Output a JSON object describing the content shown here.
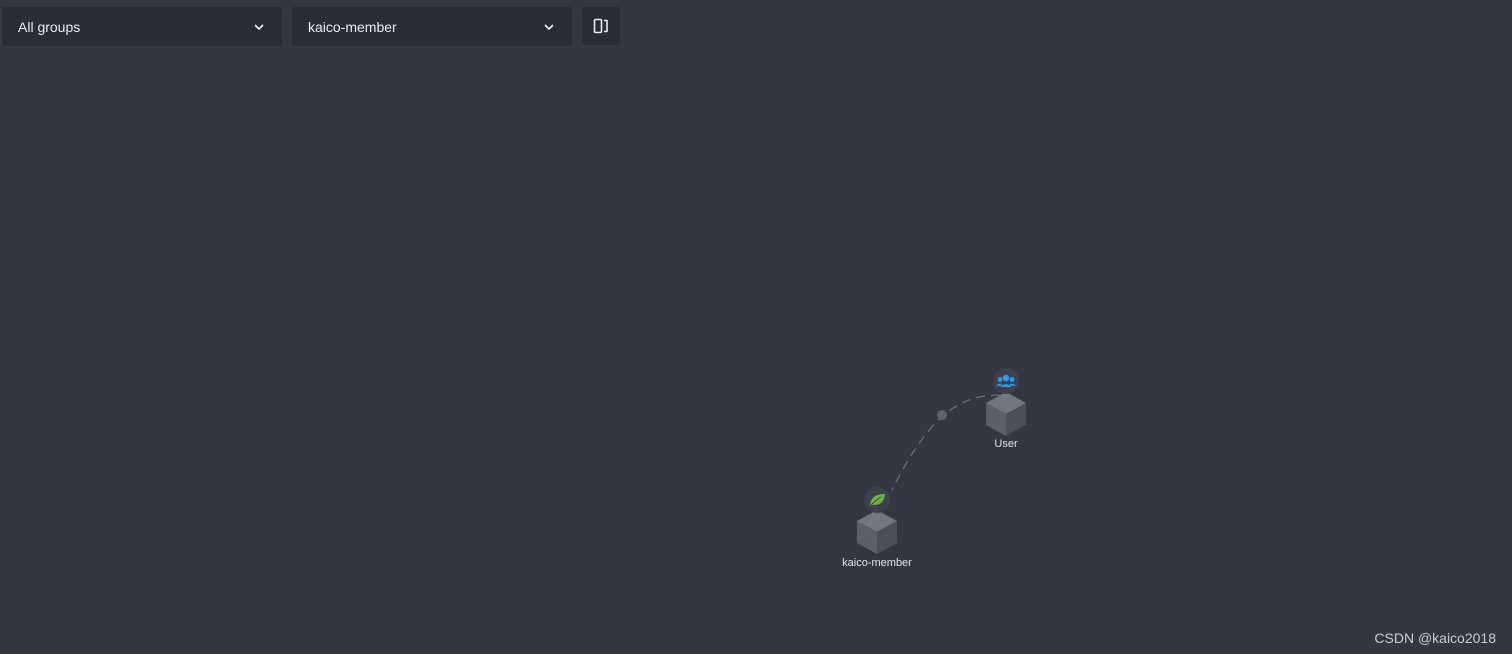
{
  "toolbar": {
    "group_select": {
      "value": "All groups",
      "icon": "chevron-down-icon"
    },
    "service_select": {
      "value": "kaico-member",
      "icon": "chevron-down-icon"
    },
    "layout_button": {
      "icon": "layout-toggle-icon"
    }
  },
  "graph": {
    "nodes": [
      {
        "id": "user",
        "label": "User",
        "badge_icon": "users-icon",
        "badge_color": "#2e9df0"
      },
      {
        "id": "kaico-member",
        "label": "kaico-member",
        "badge_icon": "spring-leaf-icon",
        "badge_color": "#6db33f"
      }
    ],
    "edges": [
      {
        "from": "user",
        "to": "kaico-member",
        "style": "dashed"
      }
    ]
  },
  "watermark": "CSDN @kaico2018",
  "colors": {
    "background": "#333741",
    "control_bg": "#2a2d35",
    "node_cube": "#5b5f6a",
    "edge": "#6b6f78"
  }
}
